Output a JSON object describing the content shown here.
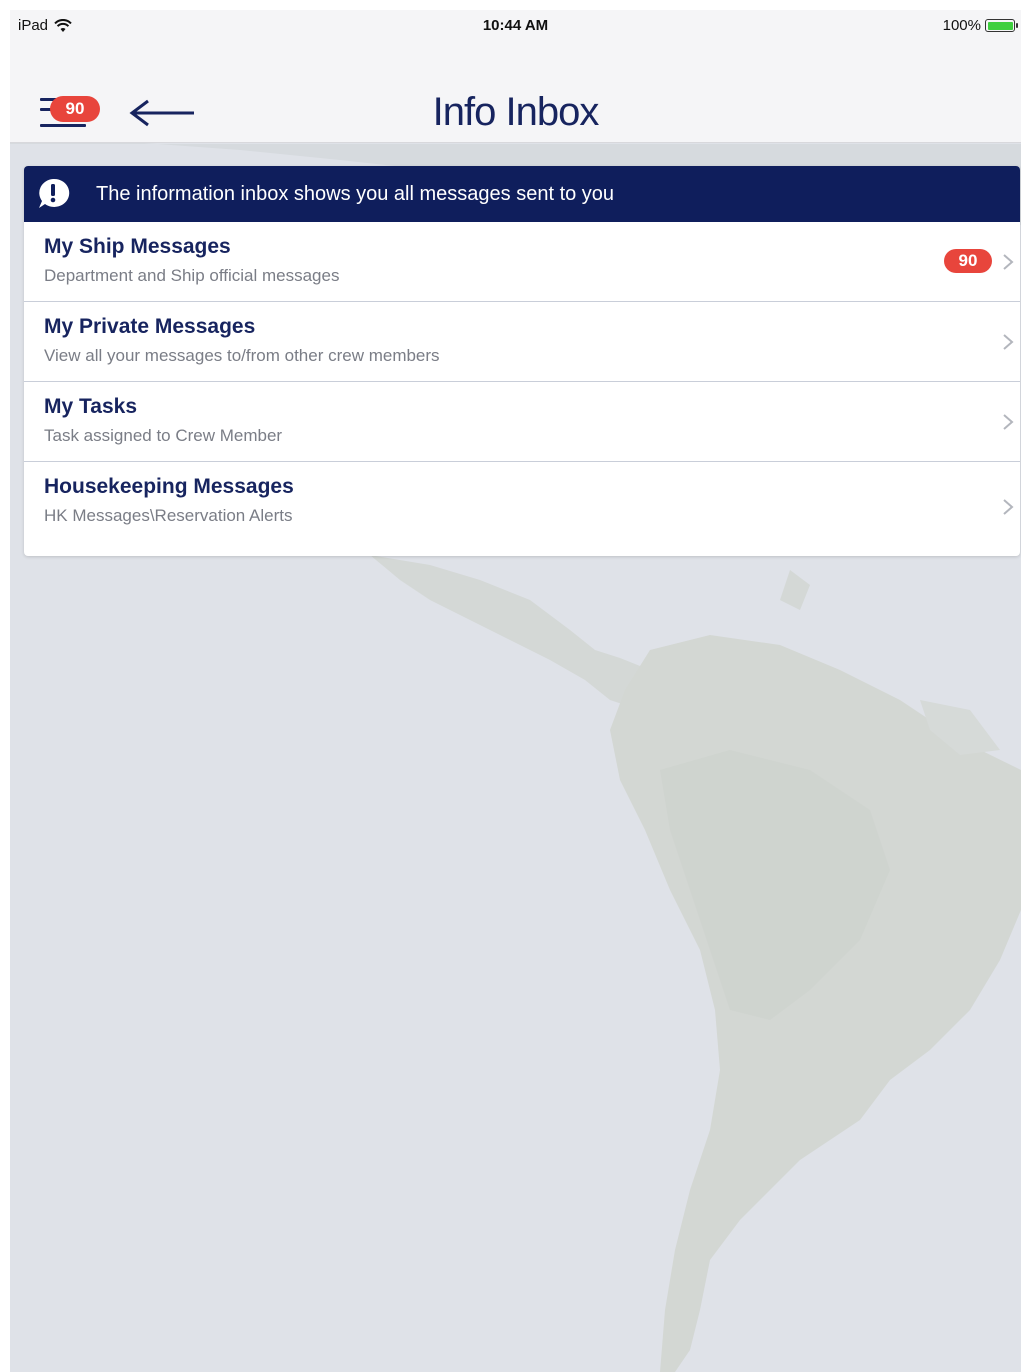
{
  "status_bar": {
    "device": "iPad",
    "time": "10:44 AM",
    "battery": "100%",
    "battery_color": "#3ecf3e"
  },
  "nav": {
    "title": "Info Inbox",
    "menu_badge": "90",
    "badge_color": "#e8453c",
    "icons": [
      "menu-icon",
      "back-arrow-icon"
    ]
  },
  "banner": {
    "text": "The information inbox shows you all messages sent to you",
    "background": "#0f1e5c",
    "icon": "alert-bubble-icon"
  },
  "items": [
    {
      "title": "My Ship Messages",
      "subtitle": "Department and Ship official messages",
      "badge": "90"
    },
    {
      "title": "My Private Messages",
      "subtitle": "View all your messages to/from other crew members",
      "badge": ""
    },
    {
      "title": "My Tasks",
      "subtitle": "Task assigned to Crew Member",
      "badge": ""
    },
    {
      "title": "Housekeeping Messages",
      "subtitle": "HK Messages\\Reservation Alerts",
      "badge": ""
    }
  ],
  "colors": {
    "accent": "#17245f",
    "badge": "#e8453c",
    "background": "#dfe2e8"
  }
}
